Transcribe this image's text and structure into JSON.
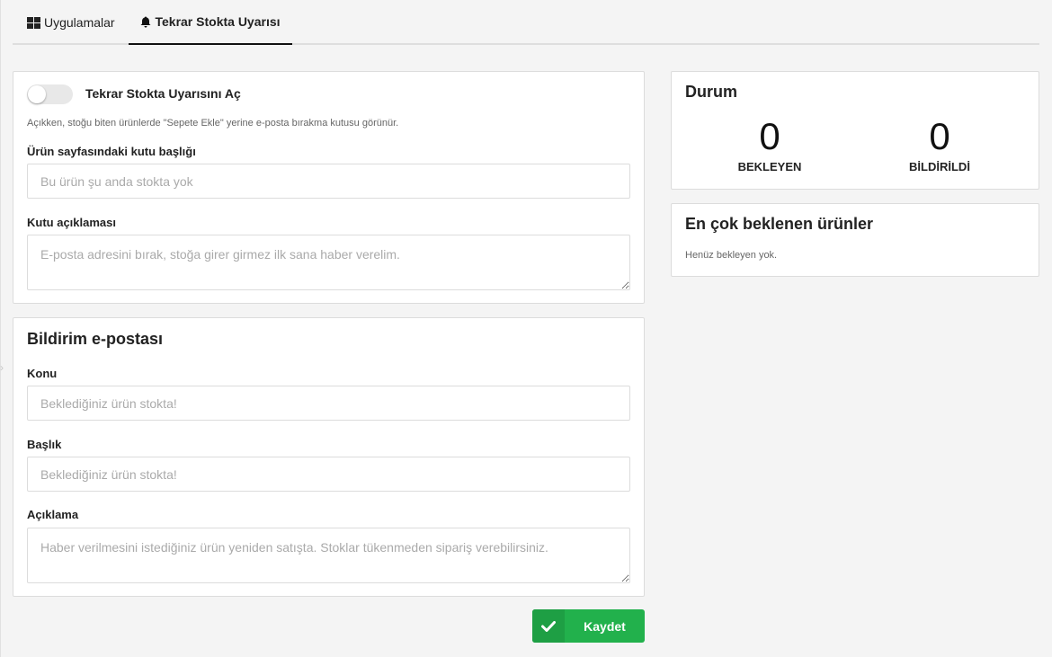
{
  "tabs": [
    {
      "label": "Uygulamalar",
      "icon": "grid-icon"
    },
    {
      "label": "Tekrar Stokta Uyarısı",
      "icon": "bell-icon",
      "active": true
    }
  ],
  "settings": {
    "toggle_label": "Tekrar Stokta Uyarısını Aç",
    "toggle_on": false,
    "hint": "Açıkken, stoğu biten ürünlerde \"Sepete Ekle\" yerine e-posta bırakma kutusu görünür.",
    "box_title_label": "Ürün sayfasındaki kutu başlığı",
    "box_title_placeholder": "Bu ürün şu anda stokta yok",
    "box_desc_label": "Kutu açıklaması",
    "box_desc_placeholder": "E-posta adresini bırak, stoğa girer girmez ilk sana haber verelim."
  },
  "email": {
    "title": "Bildirim e-postası",
    "subject_label": "Konu",
    "subject_placeholder": "Beklediğiniz ürün stokta!",
    "heading_label": "Başlık",
    "heading_placeholder": "Beklediğiniz ürün stokta!",
    "desc_label": "Açıklama",
    "desc_placeholder": "Haber verilmesini istediğiniz ürün yeniden satışta. Stoklar tükenmeden sipariş verebilirsiniz."
  },
  "status": {
    "title": "Durum",
    "waiting_value": "0",
    "waiting_label": "BEKLEYEN",
    "notified_value": "0",
    "notified_label": "BİLDİRİLDİ"
  },
  "top_products": {
    "title": "En çok beklenen ürünler",
    "empty_text": "Henüz bekleyen yok."
  },
  "actions": {
    "save_label": "Kaydet",
    "save_icon": "check-icon"
  },
  "colors": {
    "accent": "#22b14c",
    "accent_dark": "#1e9f44",
    "background": "#f4f4f4"
  }
}
